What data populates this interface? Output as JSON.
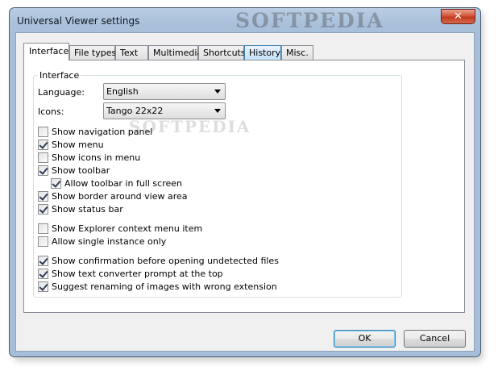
{
  "window": {
    "title": "Universal Viewer settings",
    "watermark": "SOFTPEDIA",
    "close_glyph": "✕"
  },
  "tabs": [
    {
      "label": "Interface",
      "state": "active"
    },
    {
      "label": "File types"
    },
    {
      "label": "Text"
    },
    {
      "label": "Multimedia"
    },
    {
      "label": "Shortcuts"
    },
    {
      "label": "History",
      "state": "hover"
    },
    {
      "label": "Misc."
    }
  ],
  "interface_group": {
    "title": "Interface",
    "language_label": "Language:",
    "language_value": "English",
    "icons_label": "Icons:",
    "icons_value": "Tango 22x22",
    "combo_watermark": "SOFTPEDIA"
  },
  "options": [
    {
      "label": "Show navigation panel",
      "checked": false
    },
    {
      "label": "Show menu",
      "checked": true
    },
    {
      "label": "Show icons in menu",
      "checked": false
    },
    {
      "label": "Show toolbar",
      "checked": true
    },
    {
      "label": "Allow toolbar in full screen",
      "checked": true,
      "indent": true
    },
    {
      "label": "Show border around view area",
      "checked": true
    },
    {
      "label": "Show status bar",
      "checked": true
    },
    {
      "label": "Show Explorer context menu item",
      "checked": false
    },
    {
      "label": "Allow single instance only",
      "checked": false
    },
    {
      "label": "Show confirmation before opening undetected files",
      "checked": true
    },
    {
      "label": "Show text converter prompt at the top",
      "checked": true
    },
    {
      "label": "Suggest renaming of images with wrong extension",
      "checked": true
    }
  ],
  "buttons": {
    "ok": "OK",
    "cancel": "Cancel"
  }
}
